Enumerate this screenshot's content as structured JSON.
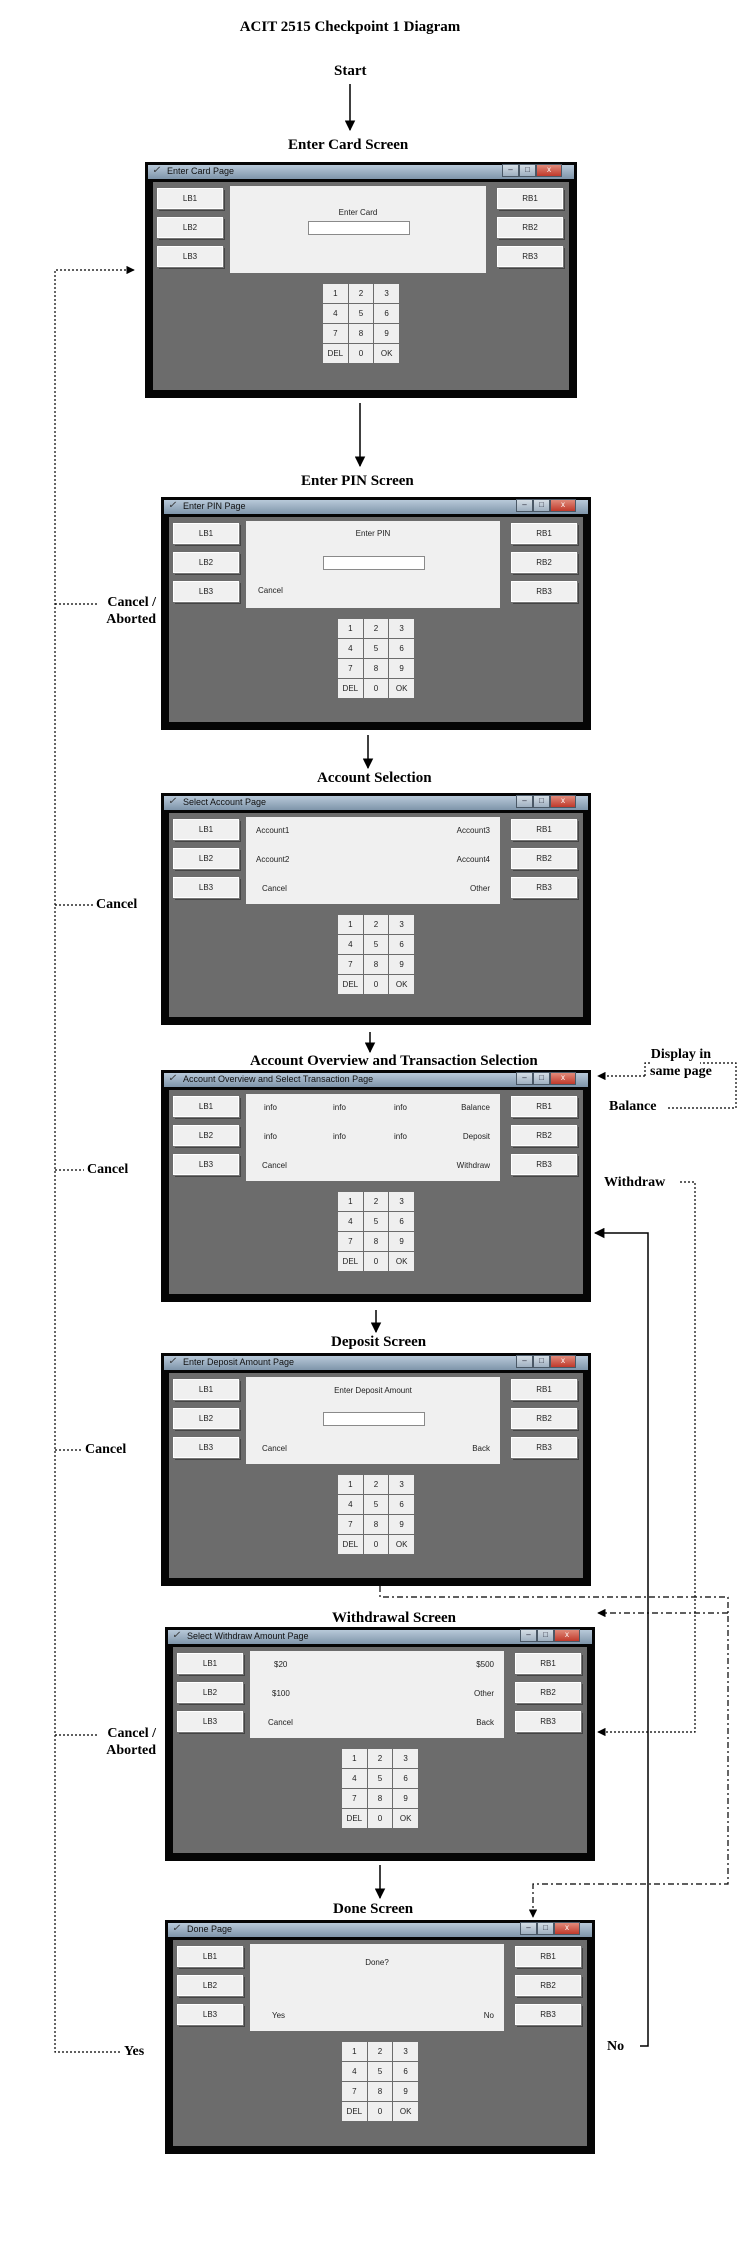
{
  "title": "ACIT 2515 Checkpoint 1 Diagram",
  "start": "Start",
  "keypad": [
    "1",
    "2",
    "3",
    "4",
    "5",
    "6",
    "7",
    "8",
    "9",
    "DEL",
    "0",
    "OK"
  ],
  "left_buttons": [
    "LB1",
    "LB2",
    "LB3"
  ],
  "right_buttons": [
    "RB1",
    "RB2",
    "RB3"
  ],
  "screens": [
    {
      "heading": "Enter Card Screen",
      "window_title": "Enter Card Page",
      "texts": [
        "Enter Card"
      ]
    },
    {
      "heading": "Enter PIN Screen",
      "window_title": "Enter PIN Page",
      "texts": [
        "Enter PIN",
        "Cancel"
      ]
    },
    {
      "heading": "Account Selection",
      "window_title": "Select Account Page",
      "texts": [
        "Account1",
        "Account3",
        "Account2",
        "Account4",
        "Cancel",
        "Other"
      ]
    },
    {
      "heading": "Account Overview and Transaction Selection",
      "window_title": "Account Overview and Select Transaction Page",
      "texts": [
        "info",
        "info",
        "info",
        "Balance",
        "info",
        "info",
        "info",
        "Deposit",
        "Cancel",
        "Withdraw"
      ]
    },
    {
      "heading": "Deposit Screen",
      "window_title": "Enter Deposit Amount Page",
      "texts": [
        "Enter Deposit Amount",
        "Cancel",
        "Back"
      ]
    },
    {
      "heading": "Withdrawal Screen",
      "window_title": "Select Withdraw Amount Page",
      "texts": [
        "$20",
        "$500",
        "$100",
        "Other",
        "Cancel",
        "Back"
      ]
    },
    {
      "heading": "Done Screen",
      "window_title": "Done Page",
      "texts": [
        "Done?",
        "Yes",
        "No"
      ]
    }
  ],
  "annotations": {
    "cancel_aborted_1": [
      "Cancel /",
      "Aborted"
    ],
    "cancel_1": "Cancel",
    "cancel_2": "Cancel",
    "cancel_3": "Cancel",
    "cancel_aborted_2": [
      "Cancel /",
      "Aborted"
    ],
    "yes": "Yes",
    "no": "No",
    "display_in_same_page": [
      "Display in",
      "same page"
    ],
    "balance": "Balance",
    "withdraw": "Withdraw"
  }
}
